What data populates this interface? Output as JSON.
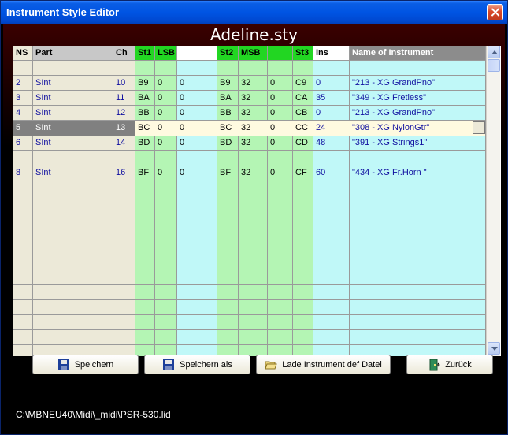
{
  "window": {
    "title": "Instrument Style Editor"
  },
  "document_title": "Adeline.sty",
  "table": {
    "headers": {
      "ns": "NS",
      "part": "Part",
      "ch": "Ch",
      "st1": "St1",
      "lsb": "LSB",
      "v1": "",
      "st2": "St2",
      "msb": "MSB",
      "v2": "",
      "st3": "St3",
      "ins": "Ins",
      "name": "Name of Instrument"
    },
    "rows": [
      {
        "ns": "",
        "part": "",
        "ch": "",
        "st1": "",
        "lsb": "",
        "v1": "",
        "st2": "",
        "msb": "",
        "v2": "",
        "st3": "",
        "ins": "",
        "name": ""
      },
      {
        "ns": "2",
        "part": "SInt",
        "ch": "10",
        "st1": "B9",
        "lsb": "0",
        "v1": "0",
        "st2": "B9",
        "msb": "32",
        "v2": "0",
        "st3": "C9",
        "ins": "0",
        "name": "\"213 - XG  GrandPno\""
      },
      {
        "ns": "3",
        "part": "SInt",
        "ch": "11",
        "st1": "BA",
        "lsb": "0",
        "v1": "0",
        "st2": "BA",
        "msb": "32",
        "v2": "0",
        "st3": "CA",
        "ins": "35",
        "name": "\"349 - XG  Fretless\""
      },
      {
        "ns": "4",
        "part": "SInt",
        "ch": "12",
        "st1": "BB",
        "lsb": "0",
        "v1": "0",
        "st2": "BB",
        "msb": "32",
        "v2": "0",
        "st3": "CB",
        "ins": "0",
        "name": "\"213 - XG  GrandPno\""
      },
      {
        "ns": "5",
        "part": "SInt",
        "ch": "13",
        "st1": "BC",
        "lsb": "0",
        "v1": "0",
        "st2": "BC",
        "msb": "32",
        "v2": "0",
        "st3": "CC",
        "ins": "24",
        "name": "\"308 - XG  NylonGtr\"",
        "selected": true
      },
      {
        "ns": "6",
        "part": "SInt",
        "ch": "14",
        "st1": "BD",
        "lsb": "0",
        "v1": "0",
        "st2": "BD",
        "msb": "32",
        "v2": "0",
        "st3": "CD",
        "ins": "48",
        "name": "\"391 - XG  Strings1\""
      },
      {
        "ns": "",
        "part": "",
        "ch": "",
        "st1": "",
        "lsb": "",
        "v1": "",
        "st2": "",
        "msb": "",
        "v2": "",
        "st3": "",
        "ins": "",
        "name": ""
      },
      {
        "ns": "8",
        "part": "SInt",
        "ch": "16",
        "st1": "BF",
        "lsb": "0",
        "v1": "0",
        "st2": "BF",
        "msb": "32",
        "v2": "0",
        "st3": "CF",
        "ins": "60",
        "name": "\"434 - XG  Fr.Horn \""
      }
    ],
    "ellipsis": "..."
  },
  "buttons": {
    "save": "Speichern",
    "save_as": "Speichern als",
    "load": "Lade Instrument def Datei",
    "back": "Zurück"
  },
  "status_path": "C:\\MBNEU40\\Midi\\_midi\\PSR-530.lid",
  "colors": {
    "titlebar": "#0054e3",
    "green_cells": "#b4f5b4",
    "cyan_cells": "#c0f8f8",
    "beige_cells": "#ece9d8",
    "header_green": "#22d622",
    "header_gray": "#8c8c8c",
    "text_blue": "#1010a0",
    "selected_row": "#808080",
    "selected_highlight": "#fffae0"
  },
  "icons": {
    "save": "floppy-disk-icon",
    "save_as": "floppy-disk-icon",
    "load": "folder-open-icon",
    "back": "exit-door-icon",
    "close": "close-icon"
  }
}
